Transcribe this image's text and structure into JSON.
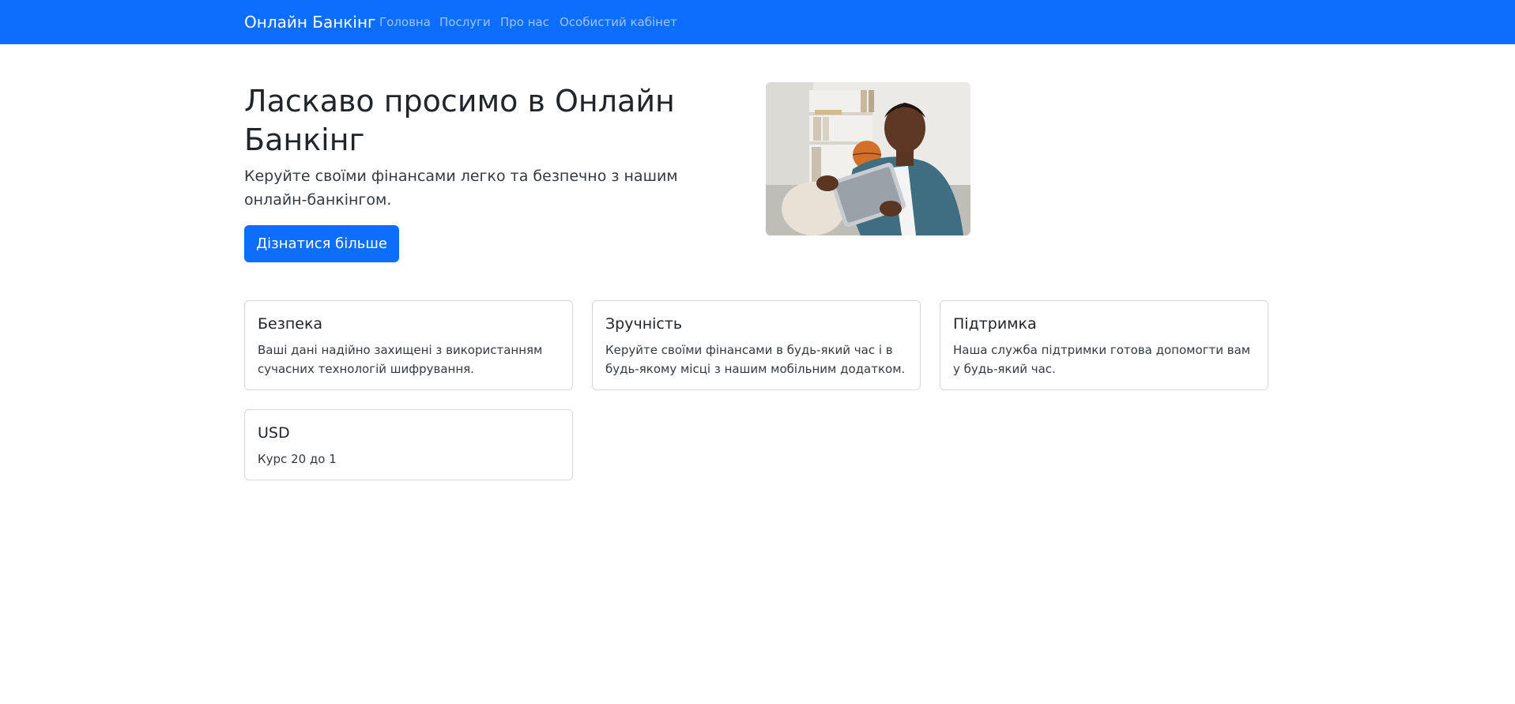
{
  "navbar": {
    "brand": "Онлайн Банкінг",
    "links": [
      "Головна",
      "Послуги",
      "Про нас",
      "Особистий кабінет"
    ],
    "background": "#0d6efd"
  },
  "hero": {
    "title": "Ласкаво просимо в Онлайн Банкінг",
    "lead": "Керуйте своїми фінансами легко та безпечно з нашим онлайн-банкінгом.",
    "button_label": "Дізнатися більше",
    "image": "photo-man-with-tablet"
  },
  "cards": [
    {
      "title": "Безпека",
      "text": "Ваші дані надійно захищені з використанням сучасних технологій шифрування."
    },
    {
      "title": "Зручність",
      "text": "Керуйте своїми фінансами в будь-який час і в будь-якому місці з нашим мобільним додатком."
    },
    {
      "title": "Підтримка",
      "text": "Наша служба підтримки готова допомогти вам у будь-який час."
    },
    {
      "title": "USD",
      "text": "Курс 20 до 1"
    }
  ],
  "colors": {
    "primary": "#0d6efd",
    "text": "#212529",
    "border": "#d6d9dc"
  }
}
